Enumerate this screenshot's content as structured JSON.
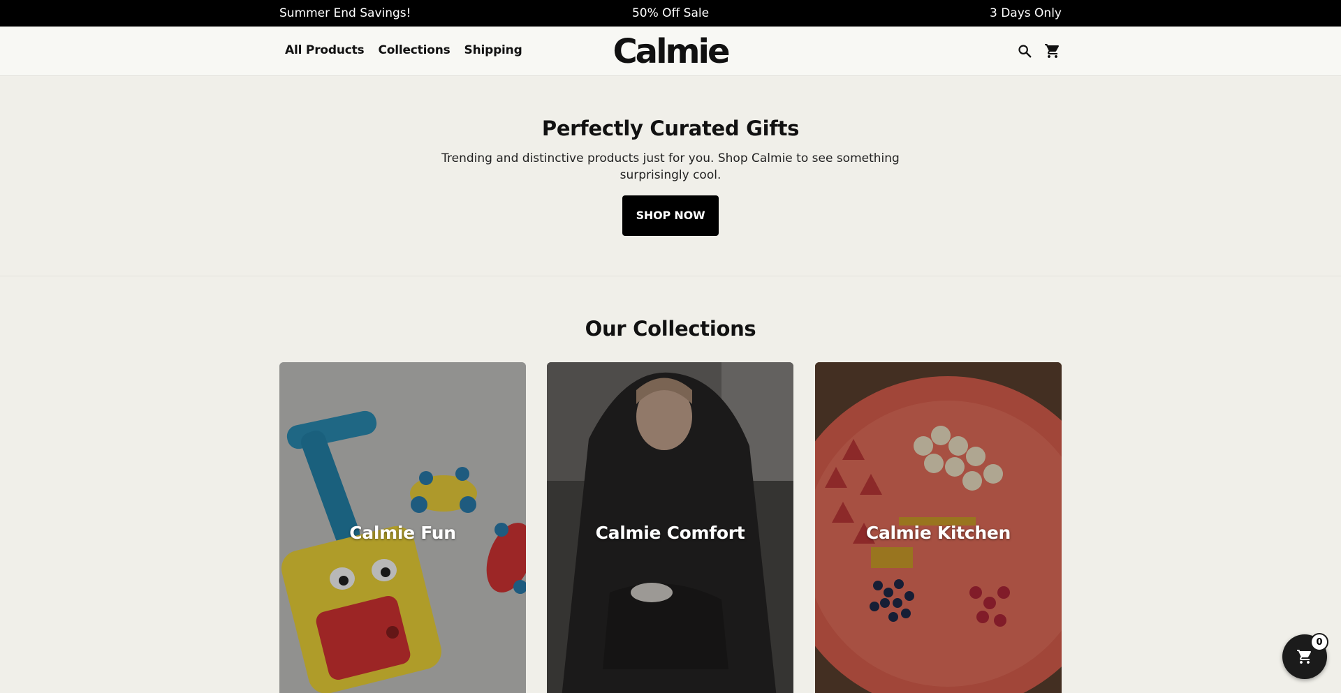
{
  "announcement": {
    "left": "Summer End Savings!",
    "center": "50% Off Sale",
    "right": "3 Days Only"
  },
  "header": {
    "logo": "Calmie",
    "nav": [
      "All Products",
      "Collections",
      "Shipping"
    ],
    "icons": [
      "search-icon",
      "cart-icon"
    ]
  },
  "hero": {
    "title": "Perfectly Curated Gifts",
    "subtitle": "Trending and distinctive products just for you. Shop Calmie to see something surprisingly cool.",
    "button": "SHOP NOW"
  },
  "collections": {
    "title": "Our Collections",
    "items": [
      {
        "label": "Calmie Fun"
      },
      {
        "label": "Calmie Comfort"
      },
      {
        "label": "Calmie Kitchen"
      }
    ]
  },
  "floating_cart": {
    "count": "0",
    "icon": "cart-icon"
  },
  "colors": {
    "background": "#f0efe9",
    "header_bg": "#f8f8f4",
    "announcement_bg": "#000000",
    "button_bg": "#000000"
  }
}
